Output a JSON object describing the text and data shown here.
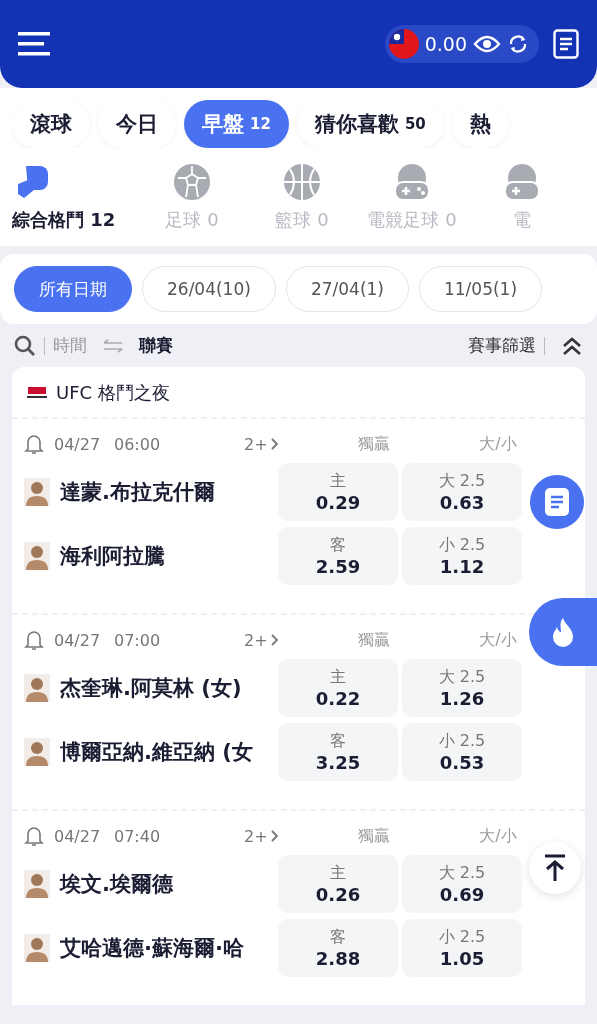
{
  "header": {
    "balance": "0.00"
  },
  "tabs": [
    {
      "label": "滾球",
      "selected": false
    },
    {
      "label": "今日",
      "selected": false
    },
    {
      "label": "早盤",
      "count": "12",
      "selected": true
    },
    {
      "label": "猜你喜歡",
      "count": "50",
      "selected": false
    },
    {
      "label": "熱",
      "selected": false
    }
  ],
  "sports": [
    {
      "kind": "boxing",
      "label": "綜合格鬥",
      "count": "12",
      "selected": true
    },
    {
      "kind": "soccer",
      "label": "足球",
      "count": "0",
      "selected": false
    },
    {
      "kind": "basketball",
      "label": "籃球",
      "count": "0",
      "selected": false
    },
    {
      "kind": "esoccer",
      "label": "電競足球",
      "count": "0",
      "selected": false
    },
    {
      "kind": "ebasketball",
      "label": "電",
      "selected": false
    }
  ],
  "dates": [
    {
      "label": "所有日期",
      "selected": true
    },
    {
      "label": "26/04(10)",
      "selected": false
    },
    {
      "label": "27/04(1)",
      "selected": false
    },
    {
      "label": "11/05(1)",
      "selected": false
    }
  ],
  "sort": [
    {
      "label": "時間",
      "selected": false
    },
    {
      "label": "聯賽",
      "selected": true
    }
  ],
  "filter_button": "賽事篩選",
  "league": {
    "name": "UFC 格鬥之夜",
    "matches": [
      {
        "date": "04/27",
        "time": "06:00",
        "more": "2+",
        "market_1": "獨贏",
        "market_2": "大/小",
        "fighters": [
          {
            "name": "達蒙.布拉克什爾",
            "win_label": "主",
            "win_odds": "0.29",
            "ou_label": "大 2.5",
            "ou_odds": "0.63"
          },
          {
            "name": "海利阿拉騰",
            "win_label": "客",
            "win_odds": "2.59",
            "ou_label": "小 2.5",
            "ou_odds": "1.12"
          }
        ]
      },
      {
        "date": "04/27",
        "time": "07:00",
        "more": "2+",
        "market_1": "獨贏",
        "market_2": "大/小",
        "fighters": [
          {
            "name": "杰奎琳.阿莫林 (女)",
            "win_label": "主",
            "win_odds": "0.22",
            "ou_label": "大 2.5",
            "ou_odds": "1.26"
          },
          {
            "name": "博爾亞納.維亞納 (女",
            "win_label": "客",
            "win_odds": "3.25",
            "ou_label": "小 2.5",
            "ou_odds": "0.53"
          }
        ]
      },
      {
        "date": "04/27",
        "time": "07:40",
        "more": "2+",
        "market_1": "獨贏",
        "market_2": "大/小",
        "fighters": [
          {
            "name": "埃文.埃爾德",
            "win_label": "主",
            "win_odds": "0.26",
            "ou_label": "大 2.5",
            "ou_odds": "0.69"
          },
          {
            "name": "艾哈邁德·蘇海爾·哈",
            "win_label": "客",
            "win_odds": "2.88",
            "ou_label": "小 2.5",
            "ou_odds": "1.05"
          }
        ]
      }
    ]
  }
}
